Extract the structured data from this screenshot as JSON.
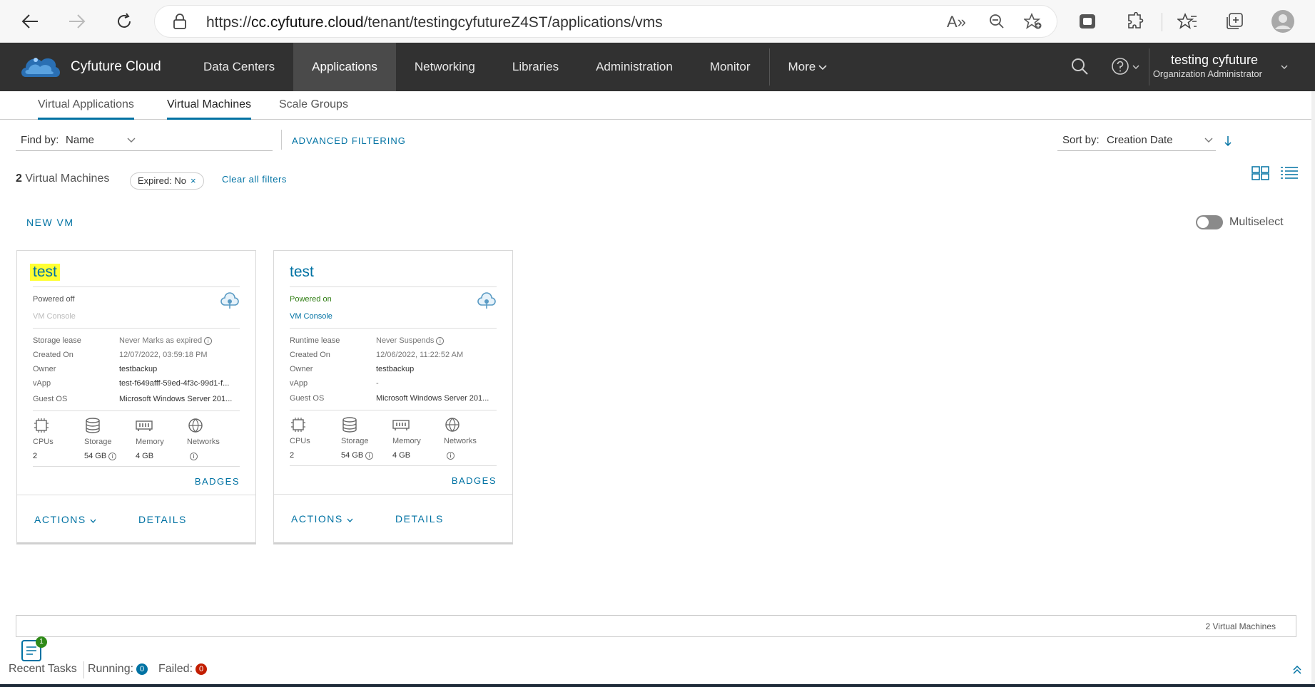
{
  "browser": {
    "url_prefix": "https://",
    "url_host": "cc.cyfuture.cloud",
    "url_path": "/tenant/testingcyfutureZ4ST/applications/vms"
  },
  "header": {
    "brand": "Cyfuture Cloud",
    "nav": [
      "Data Centers",
      "Applications",
      "Networking",
      "Libraries",
      "Administration",
      "Monitor",
      "More"
    ],
    "active_nav": "Applications",
    "user_name": "testing cyfuture",
    "user_role": "Organization Administrator"
  },
  "subtabs": [
    "Virtual Applications",
    "Virtual Machines",
    "Scale Groups"
  ],
  "filters": {
    "find_by_label": "Find by:",
    "find_by_value": "Name",
    "advanced": "ADVANCED FILTERING",
    "sort_label": "Sort by:",
    "sort_value": "Creation Date",
    "count_number": "2",
    "count_text": "Virtual Machines",
    "chip_label": "Expired:",
    "chip_value": "No",
    "chip_close": "×",
    "clear_all": "Clear all filters"
  },
  "toolbar": {
    "new_vm": "NEW VM",
    "multiselect": "Multiselect",
    "multiselect_on": false
  },
  "labels": {
    "created_on": "Created On",
    "owner": "Owner",
    "vapp": "vApp",
    "guest_os": "Guest OS",
    "cpus": "CPUs",
    "storage": "Storage",
    "memory": "Memory",
    "networks": "Networks",
    "badges": "BADGES",
    "actions": "ACTIONS",
    "details": "DETAILS",
    "info": "i"
  },
  "vms": [
    {
      "name": "test",
      "status": "Powered off",
      "console": "VM Console",
      "lease_label": "Storage lease",
      "lease_value": "Never Marks as expired",
      "created_on": "12/07/2022, 03:59:18 PM",
      "owner": "testbackup",
      "vapp": "test-f649afff-59ed-4f3c-99d1-f...",
      "guest_os": "Microsoft Windows Server 201...",
      "cpus": "2",
      "storage": "54 GB",
      "memory": "4 GB"
    },
    {
      "name": "test",
      "status": "Powered on",
      "console": "VM Console",
      "lease_label": "Runtime lease",
      "lease_value": "Never Suspends",
      "created_on": "12/06/2022, 11:22:52 AM",
      "owner": "testbackup",
      "vapp": "-",
      "guest_os": "Microsoft Windows Server 201...",
      "cpus": "2",
      "storage": "54 GB",
      "memory": "4 GB"
    }
  ],
  "footer": {
    "count": "2 Virtual Machines",
    "tasks_badge": "1",
    "recent_tasks": "Recent Tasks",
    "running_label": "Running:",
    "running_count": "0",
    "failed_label": "Failed:",
    "failed_count": "0"
  },
  "colors": {
    "header_bg": "#313131",
    "accent": "#0072a3",
    "highlight": "#ffff33",
    "powered_on": "#2f7d12",
    "failed": "#c21d00"
  }
}
